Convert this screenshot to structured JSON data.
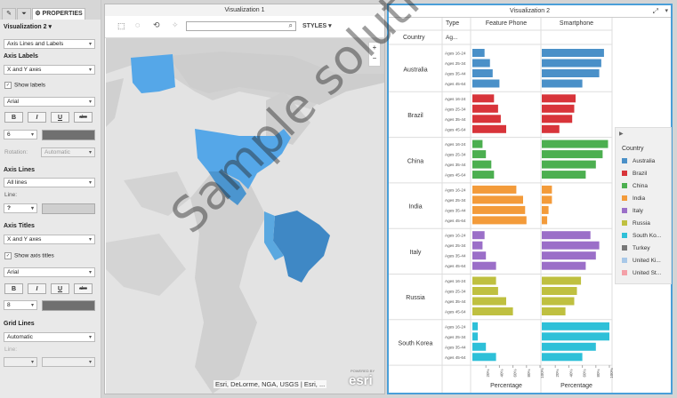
{
  "left_panel": {
    "tabs": [
      "✎",
      "⏷",
      "PROPERTIES"
    ],
    "viz_select": "Visualization 2",
    "element_select": "Axis Lines and Labels",
    "axis_labels": {
      "title": "Axis Labels",
      "select": "X and Y axes",
      "show_label": "Show labels",
      "font": "Arial",
      "bold": "B",
      "italic": "I",
      "underline": "U",
      "strike": "abc",
      "size": "6",
      "rotation_label": "Rotation:",
      "rotation_value": "Automatic"
    },
    "axis_lines": {
      "title": "Axis Lines",
      "select": "All lines",
      "line_label": "Line:",
      "line_value": "?"
    },
    "axis_titles": {
      "title": "Axis Titles",
      "select": "X and Y axes",
      "show_label": "Show axis titles",
      "font": "Arial",
      "bold": "B",
      "italic": "I",
      "underline": "U",
      "strike": "abc",
      "size": "8"
    },
    "grid_lines": {
      "title": "Grid Lines",
      "select": "Automatic",
      "line_label": "Line:"
    }
  },
  "viz1": {
    "title": "Visualization 1",
    "styles_label": "STYLES ▾",
    "search_placeholder": "",
    "attribution": "Esri, DeLorme, NGA, USGS | Esri, ...",
    "esri_powered": "POWERED BY",
    "esri_logo": "esri",
    "zoom_in": "+",
    "zoom_out": "−"
  },
  "viz2": {
    "title": "Visualization 2",
    "header_type": "Type",
    "header_feature": "Feature Phone",
    "header_smartphone": "Smartphone",
    "header_country": "Country",
    "header_age": "Ag...",
    "x_axis_title": "Percentage",
    "x_ticks": [
      "20%",
      "40%",
      "60%",
      "80%",
      "100%"
    ],
    "legend_title": "Country",
    "legend": [
      {
        "name": "Australia",
        "color": "#4a90c8"
      },
      {
        "name": "Brazil",
        "color": "#d8343a"
      },
      {
        "name": "China",
        "color": "#4caf50"
      },
      {
        "name": "India",
        "color": "#f39b3a"
      },
      {
        "name": "Italy",
        "color": "#9b6fc8"
      },
      {
        "name": "Russia",
        "color": "#bfc040"
      },
      {
        "name": "South Ko...",
        "color": "#2ec0d8"
      },
      {
        "name": "Turkey",
        "color": "#777777"
      },
      {
        "name": "United Ki...",
        "color": "#a8c8e8"
      },
      {
        "name": "United St...",
        "color": "#f4a0a8"
      }
    ]
  },
  "chart_data": {
    "type": "bar",
    "title": "Visualization 2",
    "xlabel": "Percentage",
    "xlim": [
      0,
      100
    ],
    "panels": [
      "Feature Phone",
      "Smartphone"
    ],
    "age_groups": [
      "Ages 16-24",
      "Ages 25-34",
      "Ages 35-44",
      "Ages 45-64"
    ],
    "series": [
      {
        "name": "Australia",
        "color": "#4a90c8",
        "feature": [
          18,
          26,
          30,
          40
        ],
        "smart": [
          92,
          88,
          85,
          60
        ]
      },
      {
        "name": "Brazil",
        "color": "#d8343a",
        "feature": [
          32,
          38,
          42,
          50
        ],
        "smart": [
          50,
          48,
          45,
          26
        ]
      },
      {
        "name": "China",
        "color": "#4caf50",
        "feature": [
          15,
          20,
          28,
          32
        ],
        "smart": [
          98,
          90,
          80,
          65
        ]
      },
      {
        "name": "India",
        "color": "#f39b3a",
        "feature": [
          65,
          75,
          78,
          80
        ],
        "smart": [
          15,
          15,
          10,
          8
        ]
      },
      {
        "name": "Italy",
        "color": "#9b6fc8",
        "feature": [
          18,
          15,
          20,
          35
        ],
        "smart": [
          72,
          85,
          80,
          65
        ]
      },
      {
        "name": "Russia",
        "color": "#bfc040",
        "feature": [
          35,
          38,
          50,
          60
        ],
        "smart": [
          58,
          52,
          48,
          35
        ]
      },
      {
        "name": "South Korea",
        "color": "#2ec0d8",
        "feature": [
          8,
          8,
          20,
          35
        ],
        "smart": [
          100,
          100,
          80,
          60
        ]
      }
    ]
  },
  "watermark": "Sample solution"
}
